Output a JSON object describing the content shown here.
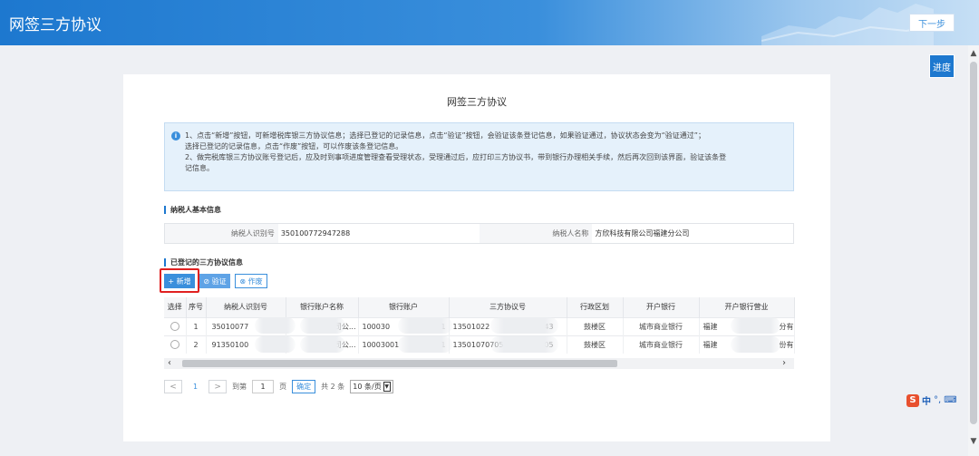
{
  "header": {
    "title": "网签三方协议",
    "next_label": "下一步"
  },
  "progress_label": "进度",
  "card": {
    "title": "网签三方协议",
    "notice_lines": [
      "1、点击“新增”按钮，可新增税库银三方协议信息；选择已登记的记录信息，点击“验证”按钮，会验证该条登记信息，如果验证通过，协议状态会变为“验证通过”；",
      "选择已登记的记录信息，点击“作废”按钮，可以作废该条登记信息。",
      "2、做完税库银三方协议账号登记后，应及时到事项进度管理查看受理状态，受理通过后，应打印三方协议书，带到银行办理相关手续，然后再次回到该界面，验证该条登",
      "记信息。"
    ],
    "basic_section_title": "纳税人基本信息",
    "taxpayer_id_label": "纳税人识别号",
    "taxpayer_id_value": "350100772947288",
    "taxpayer_name_label": "纳税人名称",
    "taxpayer_name_value": "方欣科技有限公司福建分公司",
    "registered_section_title": "已登记的三方协议信息",
    "buttons": {
      "add": "+ 新增",
      "verify": "⊘ 验证",
      "void": "⊗ 作废"
    },
    "table": {
      "headers": [
        "选择",
        "序号",
        "纳税人识别号",
        "银行账户名称",
        "银行账户",
        "三方协议号",
        "行政区划",
        "开户银行",
        "开户银行营业"
      ],
      "rows": [
        [
          "",
          "1",
          "35010077",
          "司公...",
          "100030",
          "13501022",
          "鼓楼区",
          "城市商业银行",
          "福建"
        ],
        [
          "",
          "2",
          "91350100",
          "司公...",
          "10003001",
          "13501070705",
          "鼓楼区",
          "城市商业银行",
          "福建"
        ]
      ],
      "row_tails": [
        [
          "1",
          "43",
          "分有"
        ],
        [
          "001",
          "0705",
          "份有"
        ]
      ]
    },
    "pager": {
      "prev": "<",
      "current": "1",
      "next": ">",
      "goto_label": "到第",
      "goto_value": "1",
      "page_unit": "页",
      "ok": "确定",
      "total": "共 2 条",
      "page_size": "10 条/页"
    }
  },
  "ime": {
    "s": "S",
    "lang": "中",
    "dots": "°,",
    "kb": "⌨"
  },
  "colors": {
    "header": "#1d78cf",
    "accent": "#3a8fdc",
    "highlight": "#e02020"
  }
}
